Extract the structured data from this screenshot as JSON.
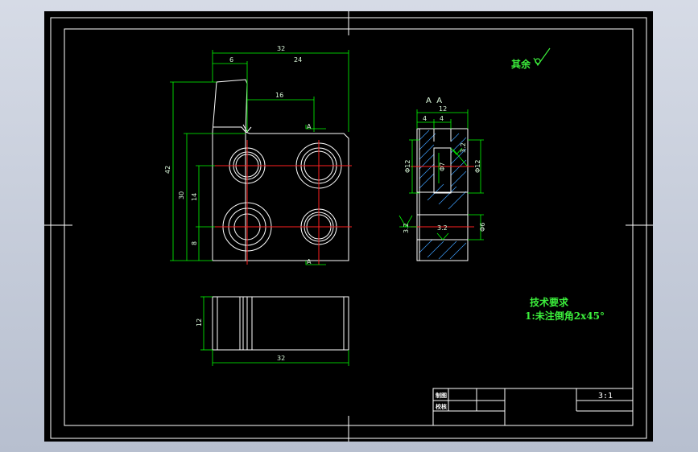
{
  "roughness_note": "其余",
  "section_label": "A  A",
  "cut_marks": [
    "A",
    "A"
  ],
  "front_view": {
    "dims": {
      "overall_width": "32",
      "slot_width": "6",
      "right_width": "24",
      "hole_offset": "16",
      "total_height": "42",
      "body_height": "30",
      "hole_spacing": "14",
      "bottom_offset": "8"
    }
  },
  "section_view": {
    "dims": {
      "top_width": "12",
      "left_part": "4",
      "mid_part": "4",
      "left_dia": "Φ12",
      "inner_dia": "Φ7",
      "right_dia": "Φ12",
      "lower_dia": "Φ6"
    },
    "roughness": [
      "3.2",
      "3.2",
      "3.2"
    ]
  },
  "bottom_view": {
    "dims": {
      "height": "12",
      "width": "32"
    }
  },
  "tech_requirements": {
    "title": "技术要求",
    "item": "1:未注倒角2x45°"
  },
  "title_block": {
    "row1_label": "制图",
    "row2_label": "校核",
    "scale": "3:1"
  },
  "colors": {
    "outline": "#ffffff",
    "dimension": "#00ff00",
    "centerline": "#ff0000",
    "hatch": "#3fa0ff",
    "text": "#3cf03c",
    "sheet": "#000000"
  }
}
